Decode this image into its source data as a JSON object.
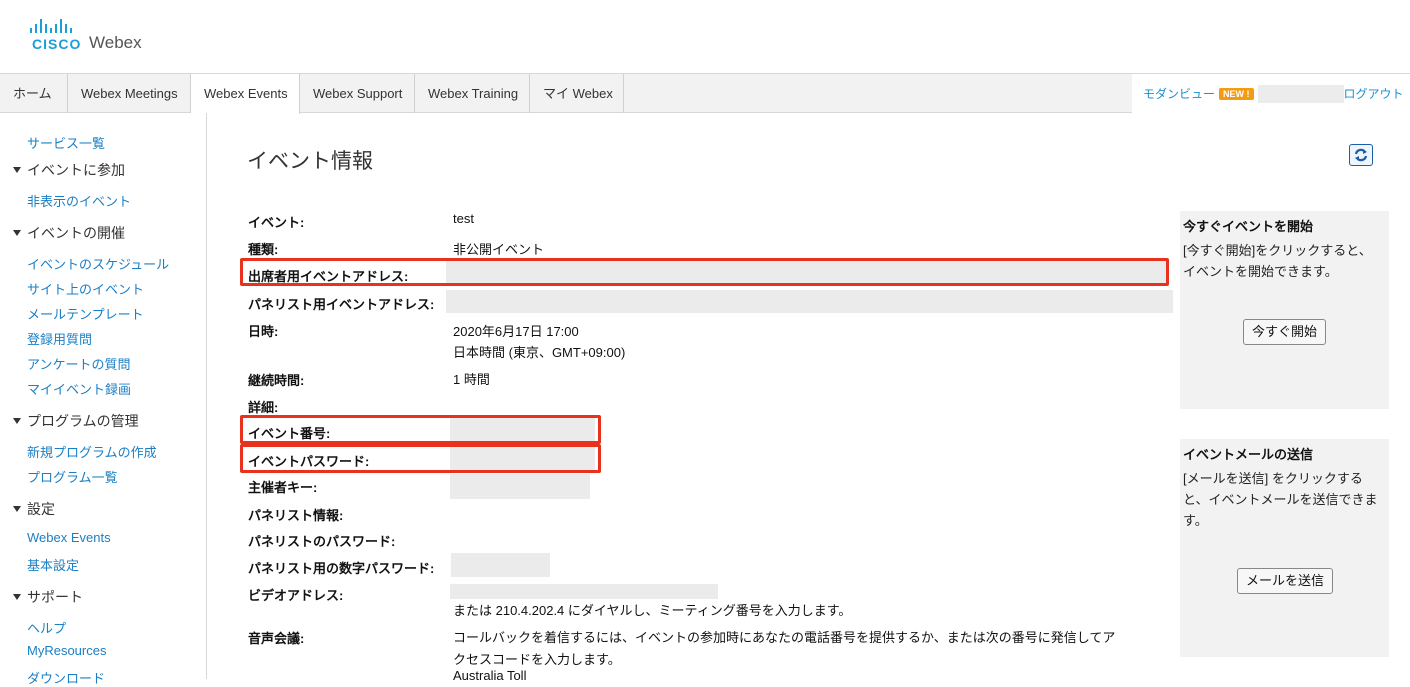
{
  "header": {
    "logo_cisco": "CISCO",
    "logo_webex": "Webex"
  },
  "nav": {
    "tabs": [
      {
        "label": "ホーム"
      },
      {
        "label": "Webex Meetings"
      },
      {
        "label": "Webex Events"
      },
      {
        "label": "Webex Support"
      },
      {
        "label": "Webex Training"
      },
      {
        "label": "マイ Webex"
      }
    ],
    "active_tab": "Webex Events",
    "modern_view": "モダンビュー",
    "new_badge": "NEW !",
    "logout": "ログアウト"
  },
  "sidebar": {
    "service_list": "サービス一覧",
    "join_head": "イベントに参加",
    "hidden_events": "非表示のイベント",
    "host_head": "イベントの開催",
    "schedule": "イベントのスケジュール",
    "site_events": "サイト上のイベント",
    "mail_templates": "メールテンプレート",
    "reg_questions": "登録用質問",
    "survey_questions": "アンケートの質問",
    "my_recordings": "マイイベント録画",
    "program_head": "プログラムの管理",
    "new_program": "新規プログラムの作成",
    "program_list": "プログラム一覧",
    "settings_head": "設定",
    "webex_events": "Webex Events",
    "basic_settings": "基本設定",
    "support_head": "サポート",
    "help": "ヘルプ",
    "myresources": "MyResources",
    "download": "ダウンロード"
  },
  "main": {
    "title": "イベント情報",
    "labels": {
      "event": "イベント:",
      "type": "種類:",
      "attendee_url": "出席者用イベントアドレス:",
      "panelist_url": "パネリスト用イベントアドレス:",
      "datetime": "日時:",
      "duration": "継続時間:",
      "details": "詳細:",
      "event_number": "イベント番号:",
      "event_password": "イベントパスワード:",
      "host_key": "主催者キー:",
      "panelist_info": "パネリスト情報:",
      "panelist_password": "パネリストのパスワード:",
      "panelist_numeric_password": "パネリスト用の数字パスワード:",
      "video_address": "ビデオアドレス:",
      "audio_conference": "音声会議:"
    },
    "values": {
      "event": "test",
      "type": "非公開イベント",
      "date": "2020年6月17日 17:00",
      "timezone": "日本時間 (東京、GMT+09:00)",
      "duration": "1 時間",
      "video_dial": "または 210.4.202.4 にダイヤルし、ミーティング番号を入力します。",
      "audio_line1": "コールバックを着信するには、イベントの参加時にあなたの電話番号を提供するか、または次の番号に発信してア",
      "audio_line2": "クセスコードを入力します。",
      "audio_line3": "Australia Toll"
    }
  },
  "panels": {
    "start": {
      "heading": "今すぐイベントを開始",
      "text": "[今すぐ開始]をクリックすると、イベントを開始できます。",
      "button": "今すぐ開始"
    },
    "mail": {
      "heading": "イベントメールの送信",
      "text": "[メールを送信] をクリックすると、イベントメールを送信できます。",
      "button": "メールを送信"
    }
  },
  "colors": {
    "link": "#1a7fc4",
    "highlight": "#e8321e",
    "badge": "#f39c12"
  }
}
